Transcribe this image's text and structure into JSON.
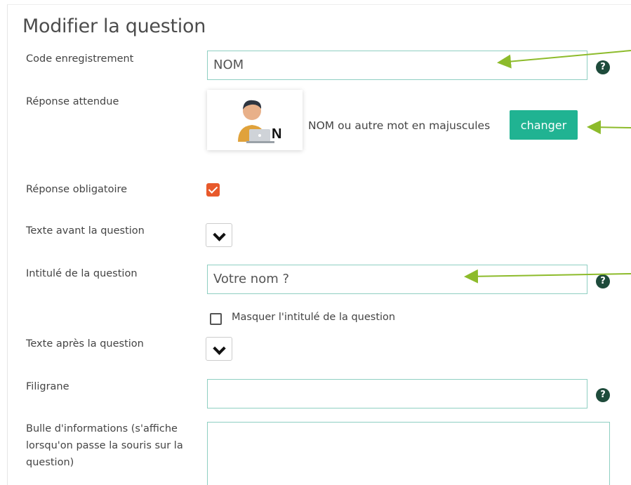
{
  "page": {
    "title": "Modifier la question"
  },
  "fields": {
    "code_label": "Code enregistrement",
    "code_value": "NOM",
    "expected_label": "Réponse attendue",
    "expected_type_badge": "N",
    "expected_description": "NOM ou autre mot en majuscules",
    "change_button": "changer",
    "mandatory_label": "Réponse obligatoire",
    "mandatory_checked": true,
    "text_before_label": "Texte avant la question",
    "question_label": "Intitulé de la question",
    "question_value": "Votre nom ?",
    "hide_question_label": "Masquer l'intitulé de la question",
    "hide_question_checked": false,
    "text_after_label": "Texte après la question",
    "watermark_label": "Filigrane",
    "watermark_value": "",
    "tooltip_label": "Bulle d'informations (s'affiche lorsqu'on passe la souris sur la question)",
    "tooltip_value": ""
  },
  "help_icon_text": "?",
  "colors": {
    "accent_button": "#20b392",
    "checkbox_checked": "#e8592b",
    "help_icon": "#1e4b3b",
    "input_border": "#8fcfc2",
    "annotation_arrow": "#8dbb2b"
  },
  "icons": {
    "help": "question-circle-icon",
    "dropdown": "chevron-down-icon",
    "avatar": "user-at-laptop-icon"
  }
}
